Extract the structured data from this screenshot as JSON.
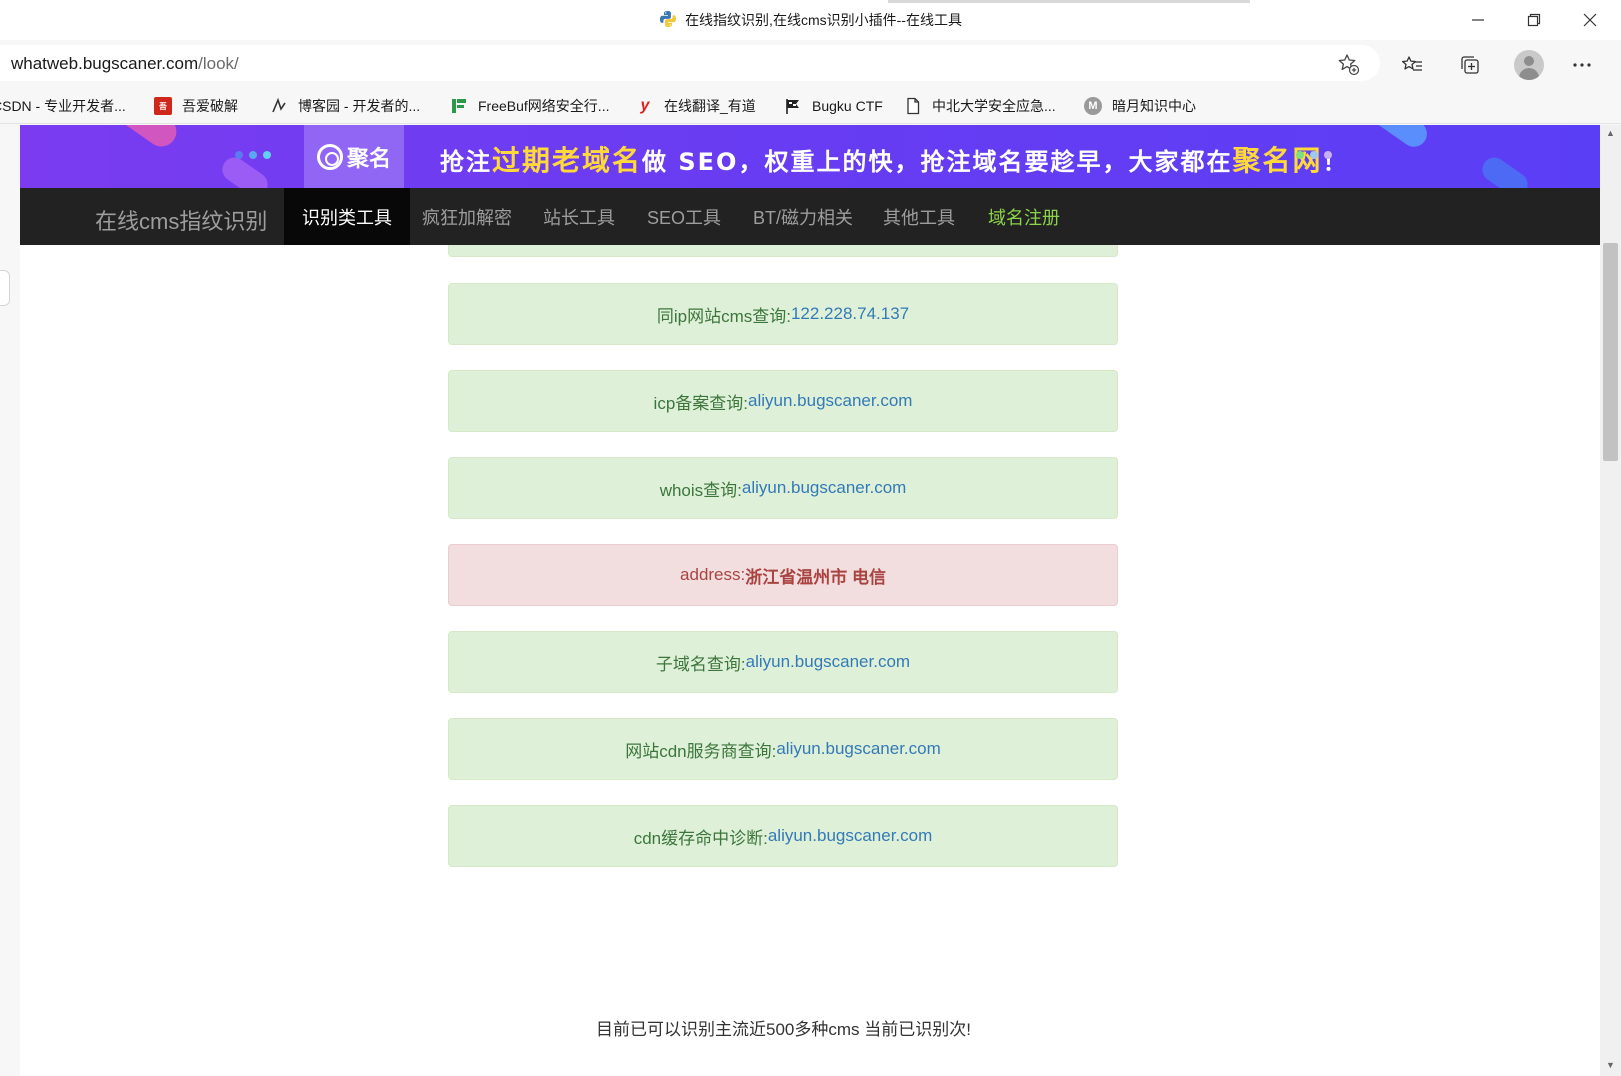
{
  "window": {
    "title": "在线指纹识别,在线cms识别小插件--在线工具"
  },
  "address_bar": {
    "domain": "whatweb.bugscaner.com",
    "path": "/look/"
  },
  "bookmarks": [
    {
      "label": "CSDN - 专业开发者...",
      "icon": "csdn-icon"
    },
    {
      "label": "吾爱破解",
      "icon": "52pojie-icon"
    },
    {
      "label": "博客园 - 开发者的...",
      "icon": "cnblogs-icon"
    },
    {
      "label": "FreeBuf网络安全行...",
      "icon": "freebuf-icon"
    },
    {
      "label": "在线翻译_有道",
      "icon": "youdao-icon"
    },
    {
      "label": "Bugku CTF",
      "icon": "flag-icon"
    },
    {
      "label": "中北大学安全应急...",
      "icon": "document-icon"
    },
    {
      "label": "暗月知识中心",
      "icon": "moon-m-icon"
    }
  ],
  "banner": {
    "logo_text": "聚名",
    "slogan": {
      "p1": "抢注",
      "h1": "过期老域名",
      "p2": "做 SEO，权重上的快，抢注域名要趁早，大家都在",
      "h2": "聚名网",
      "p3": "！"
    }
  },
  "nav": {
    "brand": "在线cms指纹识别",
    "items": [
      {
        "label": "识别类工具",
        "active": true
      },
      {
        "label": "疯狂加解密",
        "active": false
      },
      {
        "label": "站长工具",
        "active": false
      },
      {
        "label": "SEO工具",
        "active": false
      },
      {
        "label": "BT/磁力相关",
        "active": false
      },
      {
        "label": "其他工具",
        "active": false
      },
      {
        "label": "域名注册",
        "active": false,
        "highlight": true
      }
    ]
  },
  "results": [
    {
      "label": "同ip网站cms查询:",
      "value": "122.228.74.137",
      "type": "success"
    },
    {
      "label": "icp备案查询:",
      "value": "aliyun.bugscaner.com",
      "type": "success"
    },
    {
      "label": "whois查询:",
      "value": "aliyun.bugscaner.com",
      "type": "success"
    },
    {
      "label": "address:",
      "value": "浙江省温州市 电信",
      "type": "danger"
    },
    {
      "label": "子域名查询:",
      "value": "aliyun.bugscaner.com",
      "type": "success"
    },
    {
      "label": "网站cdn服务商查询:",
      "value": "aliyun.bugscaner.com",
      "type": "success"
    },
    {
      "label": "cdn缓存命中诊断:",
      "value": "aliyun.bugscaner.com",
      "type": "success"
    }
  ],
  "footnote": "目前已可以识别主流近500多种cms 当前已识别次!",
  "colors": {
    "success_bg": "#dff0d8",
    "success_text": "#3c763d",
    "danger_bg": "#f2dede",
    "danger_text": "#a94442",
    "link": "#337ab7",
    "nav_bg": "#222222",
    "nav_highlight": "#8bd34a"
  }
}
